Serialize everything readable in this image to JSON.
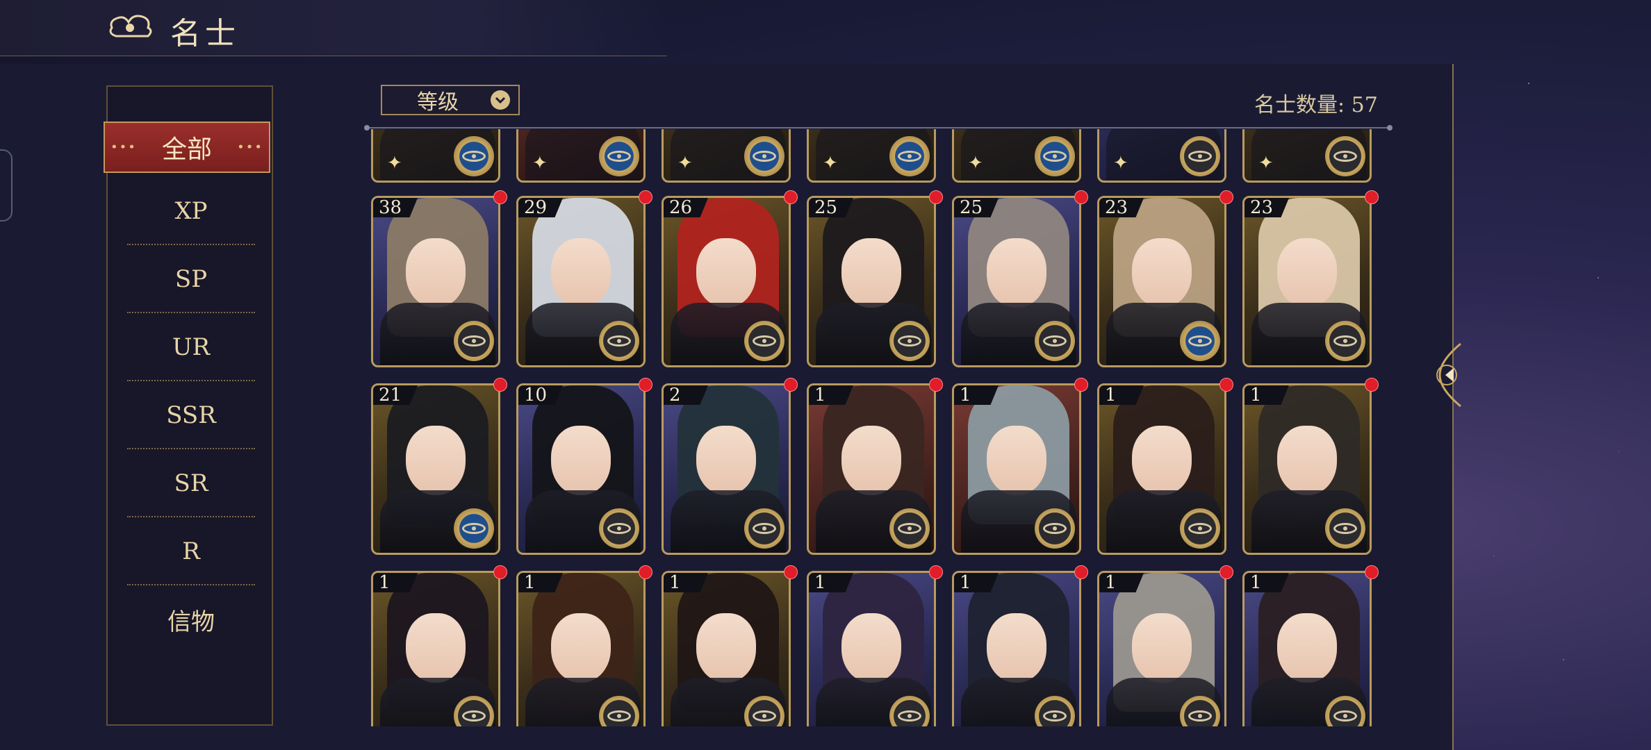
{
  "header": {
    "title": "名士"
  },
  "sidebar": {
    "items": [
      {
        "label": "全部",
        "active": true
      },
      {
        "label": "XP"
      },
      {
        "label": "SP"
      },
      {
        "label": "UR"
      },
      {
        "label": "SSR"
      },
      {
        "label": "SR"
      },
      {
        "label": "R"
      },
      {
        "label": "信物"
      }
    ]
  },
  "toolbar": {
    "sort_label": "等级",
    "count_label": "名士数量: 57"
  },
  "colors": {
    "accent_red": "#9a2f2c",
    "gold": "#b99b5f",
    "badge_red_dot": "#e01d28"
  },
  "top_row": [
    {
      "badge": "blue",
      "bg": "gold"
    },
    {
      "badge": "blue",
      "bg": "red"
    },
    {
      "badge": "blue",
      "bg": "gold"
    },
    {
      "badge": "blue",
      "bg": "gold"
    },
    {
      "badge": "blue",
      "bg": "gold"
    },
    {
      "badge": "dark",
      "bg": "purple"
    },
    {
      "badge": "dark",
      "bg": "gold"
    }
  ],
  "rows": [
    [
      {
        "level": "38",
        "bg": "purple",
        "hair": "#8a7a66",
        "badge": "dark"
      },
      {
        "level": "29",
        "bg": "gold",
        "hair": "#d4d8e0",
        "badge": "dark"
      },
      {
        "level": "26",
        "bg": "gold",
        "hair": "#b0241f",
        "badge": "dark"
      },
      {
        "level": "25",
        "bg": "gold",
        "hair": "#1e1a1e",
        "badge": "dark"
      },
      {
        "level": "25",
        "bg": "purple",
        "hair": "#8f8580",
        "badge": "dark"
      },
      {
        "level": "23",
        "bg": "gold",
        "hair": "#b9a182",
        "badge": "blue"
      },
      {
        "level": "23",
        "bg": "gold",
        "hair": "#d9c6a8",
        "badge": "dark"
      }
    ],
    [
      {
        "level": "21",
        "bg": "gold",
        "hair": "#1b1c22",
        "badge": "blue"
      },
      {
        "level": "10",
        "bg": "purple",
        "hair": "#141419",
        "badge": "dark"
      },
      {
        "level": "2",
        "bg": "purple",
        "hair": "#23323a",
        "badge": "dark"
      },
      {
        "level": "1",
        "bg": "red",
        "hair": "#3a2622",
        "badge": "dark"
      },
      {
        "level": "1",
        "bg": "red",
        "hair": "#8b9aa0",
        "badge": "dark"
      },
      {
        "level": "1",
        "bg": "gold",
        "hair": "#2b1d1a",
        "badge": "dark"
      },
      {
        "level": "1",
        "bg": "gold",
        "hair": "#2e2a26",
        "badge": "dark"
      }
    ],
    [
      {
        "level": "1",
        "bg": "gold",
        "hair": "#1c1620",
        "badge": "dark"
      },
      {
        "level": "1",
        "bg": "gold",
        "hair": "#3d2418",
        "badge": "dark"
      },
      {
        "level": "1",
        "bg": "gold",
        "hair": "#201615",
        "badge": "dark"
      },
      {
        "level": "1",
        "bg": "purple",
        "hair": "#2d2440",
        "badge": "dark"
      },
      {
        "level": "1",
        "bg": "purple",
        "hair": "#1d2230",
        "badge": "dark"
      },
      {
        "level": "1",
        "bg": "purple",
        "hair": "#9a968e",
        "badge": "dark"
      },
      {
        "level": "1",
        "bg": "purple",
        "hair": "#2a1f22",
        "badge": "dark"
      }
    ]
  ]
}
